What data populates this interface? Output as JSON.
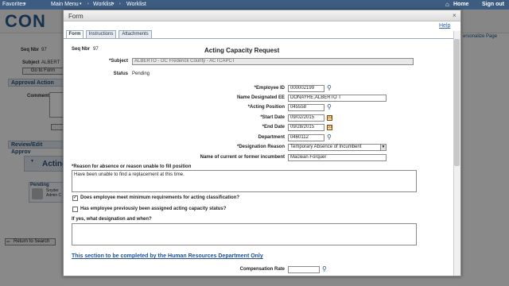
{
  "topbar": {
    "favorites": "Favorites",
    "main_menu": "Main Menu",
    "worklist_1": "Worklist",
    "worklist_2": "Worklist",
    "home": "Home",
    "sign_out": "Sign out"
  },
  "background": {
    "logo": "CON",
    "seq_label": "Seq Nbr",
    "seq_value": "97",
    "subject_label": "Subject",
    "subject_value": "ALBERT",
    "go_to_form": "Go to Form",
    "approval_action": "Approval Action",
    "comment_label": "Comment",
    "review_section": "Review/Edit Approv",
    "acting_label": "Acting",
    "pending_label": "Pending",
    "pending_name": "Snyder",
    "pending_role": "Admin C",
    "personalize": "ersonalize Page",
    "return_to_search": "Return to Search"
  },
  "modal": {
    "title": "Form",
    "close": "×",
    "help": "Help",
    "tabs": [
      "Form",
      "Instructions",
      "Attachments"
    ],
    "seq_label": "Seq Nbr",
    "seq_value": "97",
    "heading": "Acting Capacity Request",
    "subject_label": "*Subject",
    "subject_value": "ALBERTO - DC Frederick County - ACTCAPCT",
    "status_label": "Status",
    "status_value": "Pending",
    "employee_id_label": "*Employee ID",
    "employee_id": "000002199",
    "name_designated_label": "Name Designated EE",
    "name_designated": "DONAYRE,ALBERTO T",
    "acting_position_label": "*Acting Position",
    "acting_position": "045558",
    "start_date_label": "*Start Date",
    "start_date": "09/02/2015",
    "end_date_label": "*End Date",
    "end_date": "09/28/2015",
    "department_label": "Department",
    "department": "0460112",
    "designation_reason_label": "*Designation Reason",
    "designation_reason": "Temporary Absence of Incumbent",
    "incumbent_label": "Name of current or former incumbent",
    "incumbent": "Maclean Forquer",
    "reason_label": "*Reason for absence or reason unable to fill position",
    "reason_text": "Have been unable to find a replacement at this time.",
    "min_req_label": "Does employee meet minimum requirements for acting classification?",
    "min_req_checked": true,
    "previously_label": "Has employee previously been assigned acting capacity status?",
    "previously_checked": false,
    "if_yes_label": "If yes, what designation and when?",
    "hr_section_link": "This section to be completed by the Human Resources Department Only",
    "compensation_rate_label": "Compensation Rate"
  },
  "icons": {
    "search": "search-icon",
    "calendar": "calendar-icon",
    "dropdown": "chevron-down-icon"
  },
  "colors": {
    "topbar": "#3d5c82",
    "link": "#1f4f96",
    "section_bar": "#dfe6ef"
  }
}
